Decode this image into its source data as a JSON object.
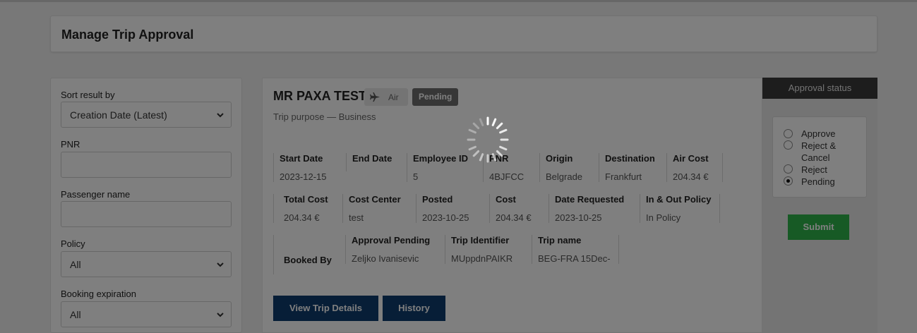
{
  "page": {
    "title": "Manage Trip Approval"
  },
  "filters": {
    "sort_label": "Sort result by",
    "sort_value": "Creation Date (Latest)",
    "pnr_label": "PNR",
    "pnr_value": "",
    "passenger_label": "Passenger name",
    "passenger_value": "",
    "policy_label": "Policy",
    "policy_value": "All",
    "expiration_label": "Booking expiration",
    "expiration_value": "All"
  },
  "trip": {
    "passenger": "MR PAXA TEST",
    "mode_icon": "plane-icon",
    "mode": "Air",
    "status": "Pending",
    "purpose": "Trip purpose — Business",
    "fields": {
      "start_date": {
        "label": "Start Date",
        "value": "2023-12-15"
      },
      "end_date": {
        "label": "End Date",
        "value": ""
      },
      "employee_id": {
        "label": "Employee ID",
        "value": "5"
      },
      "pnr": {
        "label": "PNR",
        "value": "4BJFCC"
      },
      "origin": {
        "label": "Origin",
        "value": "Belgrade"
      },
      "destination": {
        "label": "Destination",
        "value": "Frankfurt"
      },
      "air_cost": {
        "label": "Air Cost",
        "value": "204.34 €"
      },
      "total_cost": {
        "label": "Total Cost",
        "value": "204.34 €"
      },
      "cost_center": {
        "label": "Cost Center",
        "value": "test"
      },
      "posted": {
        "label": "Posted",
        "value": "2023-10-25"
      },
      "cost": {
        "label": "Cost",
        "value": "204.34 €"
      },
      "date_requested": {
        "label": "Date Requested",
        "value": "2023-10-25"
      },
      "in_out_policy": {
        "label": "In & Out Policy",
        "value": "In Policy"
      },
      "booked_by": {
        "label": "Booked By",
        "value": ""
      },
      "approval_pending": {
        "label": "Approval Pending",
        "value": "Zeljko Ivanisevic"
      },
      "trip_identifier": {
        "label": "Trip Identifier",
        "value": "MUppdnPAIKR"
      },
      "trip_name": {
        "label": "Trip name",
        "value": "BEG-FRA 15Dec-"
      }
    },
    "view_details_label": "View Trip Details",
    "history_label": "History"
  },
  "approval": {
    "header": "Approval status",
    "options": [
      "Approve",
      "Reject & Cancel",
      "Reject",
      "Pending"
    ],
    "selected": "Pending",
    "submit_label": "Submit"
  },
  "colors": {
    "primary_button": "#0f3d6e",
    "submit_button": "#2fb44a",
    "status_badge": "#6f6f6f",
    "overlay": "rgba(0,0,0,0.5)"
  }
}
